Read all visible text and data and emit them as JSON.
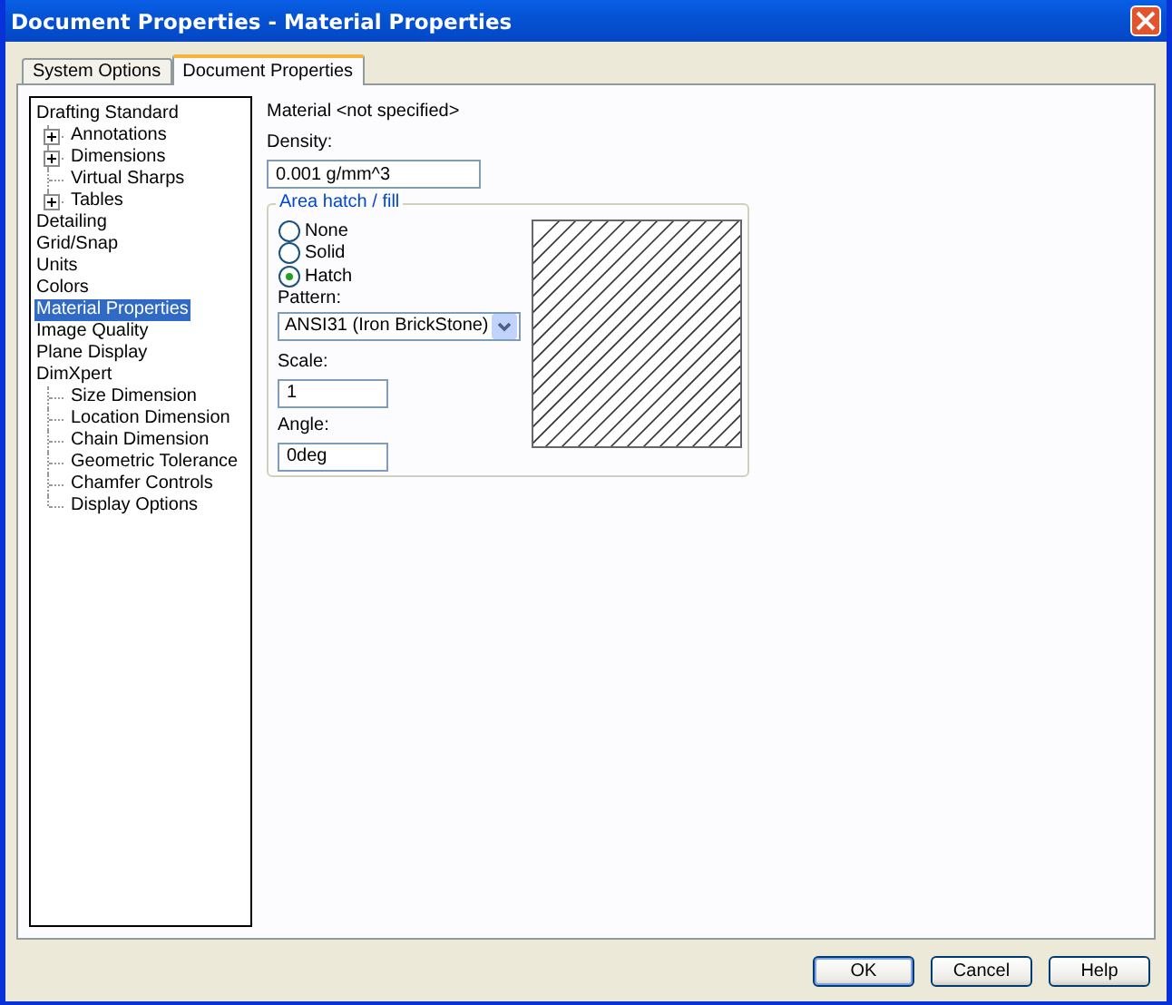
{
  "window": {
    "title": "Document Properties - Material Properties"
  },
  "tabs": [
    {
      "label": "System Options",
      "selected": false
    },
    {
      "label": "Document Properties",
      "selected": true
    }
  ],
  "tree": [
    {
      "label": "Drafting Standard",
      "selected": false,
      "children": [
        {
          "label": "Annotations",
          "selected": false,
          "expanded": false
        },
        {
          "label": "Dimensions",
          "selected": false,
          "expanded": false
        },
        {
          "label": "Virtual Sharps",
          "selected": false
        },
        {
          "label": "Tables",
          "selected": false,
          "expanded": false
        }
      ]
    },
    {
      "label": "Detailing",
      "selected": false
    },
    {
      "label": "Grid/Snap",
      "selected": false
    },
    {
      "label": "Units",
      "selected": false
    },
    {
      "label": "Colors",
      "selected": false
    },
    {
      "label": "Material Properties",
      "selected": true
    },
    {
      "label": "Image Quality",
      "selected": false
    },
    {
      "label": "Plane Display",
      "selected": false
    },
    {
      "label": "DimXpert",
      "selected": false,
      "children": [
        {
          "label": "Size Dimension",
          "selected": false
        },
        {
          "label": "Location Dimension",
          "selected": false
        },
        {
          "label": "Chain Dimension",
          "selected": false
        },
        {
          "label": "Geometric Tolerance",
          "selected": false
        },
        {
          "label": "Chamfer Controls",
          "selected": false
        },
        {
          "label": "Display Options",
          "selected": false
        }
      ]
    }
  ],
  "material": "Material <not specified>",
  "density": {
    "label": "Density:",
    "value": "0.001 g/mm^3"
  },
  "area_hatch": {
    "title": "Area hatch / fill",
    "options": [
      {
        "label": "None",
        "selected": false
      },
      {
        "label": "Solid",
        "selected": false
      },
      {
        "label": "Hatch",
        "selected": true
      }
    ],
    "pattern": {
      "label": "Pattern:",
      "value": "ANSI31 (Iron BrickStone)"
    },
    "scale": {
      "label": "Scale:",
      "value": "1"
    },
    "angle": {
      "label": "Angle:",
      "value": "0deg"
    }
  },
  "buttons": [
    "OK",
    "Cancel",
    "Help"
  ]
}
